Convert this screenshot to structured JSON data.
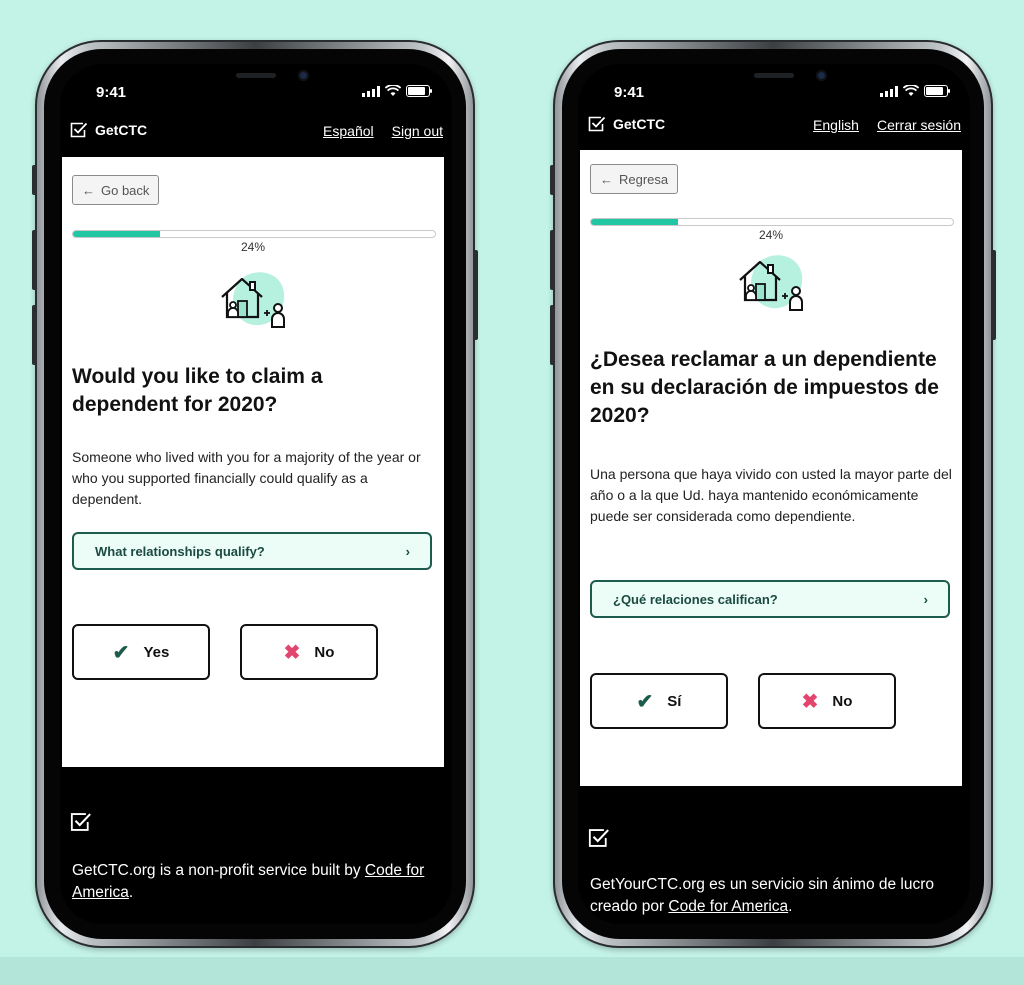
{
  "colors": {
    "accent": "#21c6a2",
    "check": "#1d5b4d",
    "cross": "#e2456d",
    "background": "#c3f3e6"
  },
  "left": {
    "status_time": "9:41",
    "brand": "GetCTC",
    "links": [
      "Español",
      "Sign out"
    ],
    "back_label": "Go back",
    "progress_percent": 24,
    "progress_label": "24%",
    "illustration": "house-with-dependent-icon",
    "title": "Would you like to claim a dependent for 2020?",
    "description": "Someone who lived with you for a majority of the year or who you supported financially could qualify as a dependent.",
    "qualify_link": "What relationships qualify?",
    "yes_label": "Yes",
    "no_label": "No",
    "footer_text_1": "GetCTC.org is a non-profit service built by ",
    "footer_link": "Code for America",
    "footer_text_2": "."
  },
  "right": {
    "status_time": "9:41",
    "brand": "GetCTC",
    "links": [
      "English",
      "Cerrar sesión"
    ],
    "back_label": "Regresa",
    "progress_percent": 24,
    "progress_label": "24%",
    "illustration": "house-with-dependent-icon",
    "title": "¿Desea reclamar a un dependiente en su declaración de impuestos de 2020?",
    "description": "Una persona que haya vivido con usted la mayor parte del año o a la que Ud. haya mantenido económicamente puede ser considerada como dependiente.",
    "qualify_link": "¿Qué relaciones califican?",
    "yes_label": "Sí",
    "no_label": "No",
    "footer_text_1": "GetYourCTC.org es un servicio sin ánimo de lucro creado por ",
    "footer_link": "Code for America",
    "footer_text_2": "."
  }
}
